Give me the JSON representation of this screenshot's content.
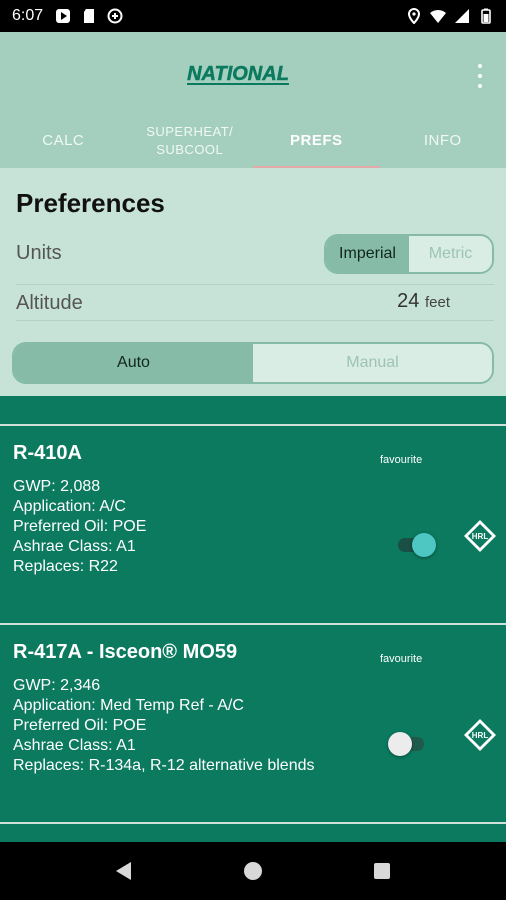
{
  "status_bar": {
    "time": "6:07"
  },
  "appbar": {
    "logo_text": "NATIONAL",
    "tabs": [
      {
        "label": "CALC"
      },
      {
        "label": "SUPERHEAT/\nSUBCOOL"
      },
      {
        "label": "PREFS"
      },
      {
        "label": "INFO"
      }
    ]
  },
  "prefs": {
    "title": "Preferences",
    "units_label": "Units",
    "units_options": [
      "Imperial",
      "Metric"
    ],
    "units_selected": "Imperial",
    "altitude_label": "Altitude",
    "altitude_value": "24",
    "altitude_unit": "feet",
    "mode_options": [
      "Auto",
      "Manual"
    ],
    "mode_selected": "Auto"
  },
  "refrigerants": [
    {
      "name": "R-410A",
      "favourite_label": "favourite",
      "favourite": true,
      "gwp": "GWP: 2,088",
      "application": "Application: A/C",
      "oil": "Preferred Oil: POE",
      "ashrae": "Ashrae Class: A1",
      "replaces": "Replaces: R22",
      "badge_text": "HRL"
    },
    {
      "name": "R-417A - Isceon® MO59",
      "favourite_label": "favourite",
      "favourite": false,
      "gwp": "GWP: 2,346",
      "application": "Application: Med Temp Ref - A/C",
      "oil": "Preferred Oil: POE",
      "ashrae": "Ashrae Class: A1",
      "replaces": "Replaces: R-134a, R-12 alternative blends",
      "badge_text": "HRL"
    }
  ],
  "colors": {
    "appbar": "#a4cfbf",
    "prefs_bg": "#c7e3d8",
    "list_bg": "#0b7a5f",
    "switch_on_thumb": "#4ec6c2",
    "switch_on_track": "#1a4f45",
    "switch_off_thumb": "#ececec",
    "switch_off_track": "#1e5a4c"
  }
}
